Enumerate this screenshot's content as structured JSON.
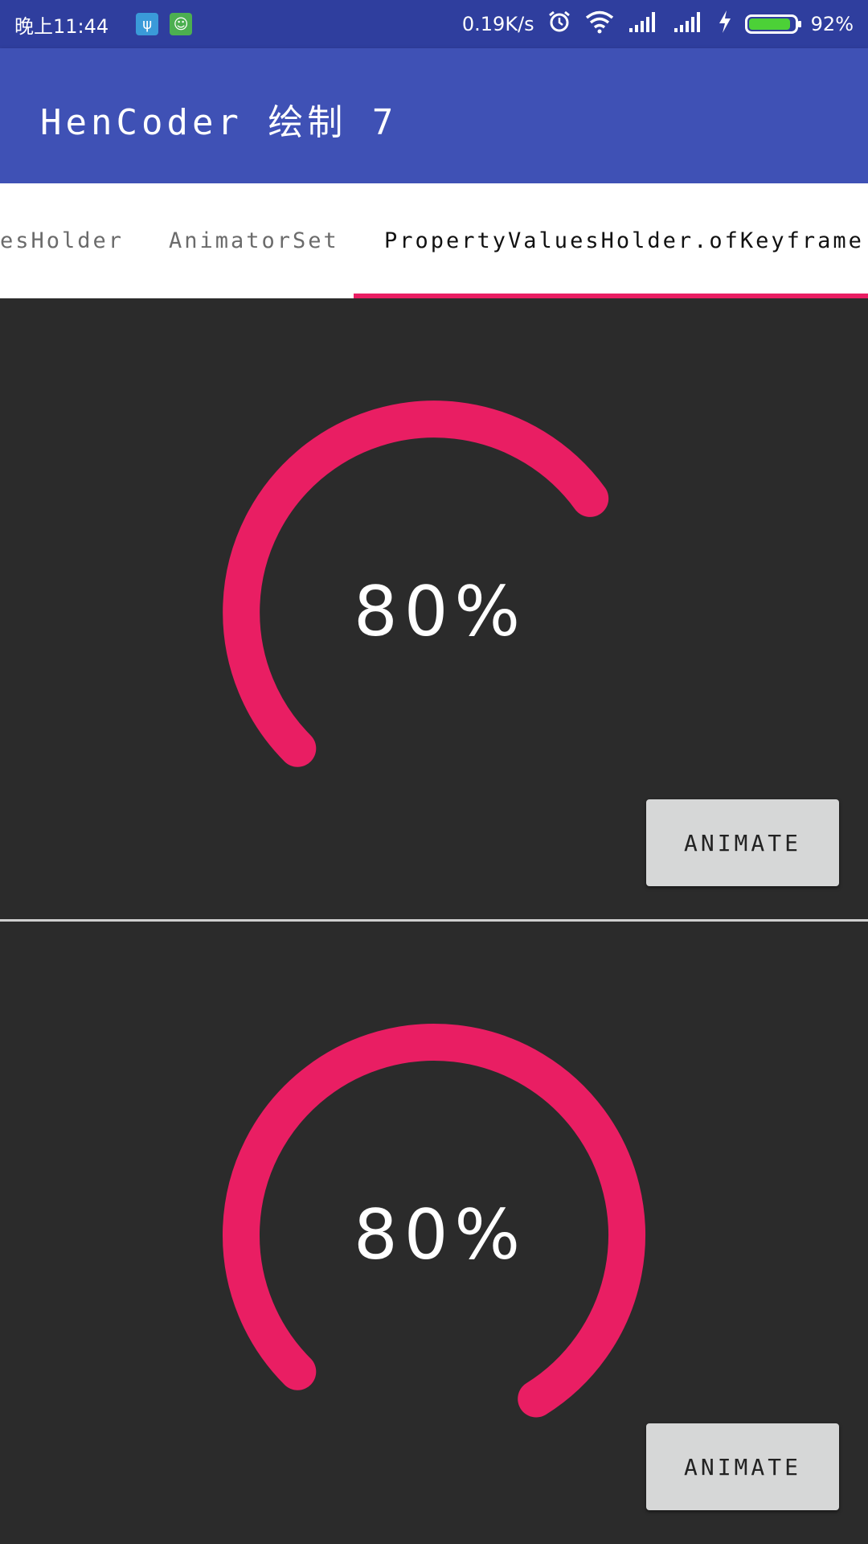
{
  "status_bar": {
    "time": "晚上11:44",
    "usb_icon": "usb-icon",
    "notification_icon": "android-icon",
    "net_speed": "0.19K/s",
    "battery_percent": "92%",
    "battery_level": 0.92,
    "icons": [
      "alarm-icon",
      "wifi-icon",
      "signal-icon",
      "signal-icon",
      "charging-icon",
      "battery-icon"
    ]
  },
  "app_bar": {
    "title": "HenCoder 绘制 7"
  },
  "tabs": {
    "items": [
      {
        "label": "esHolder",
        "active": false
      },
      {
        "label": "AnimatorSet",
        "active": false
      },
      {
        "label": "PropertyValuesHolder.ofKeyframe()",
        "active": true
      }
    ],
    "indicator_color": "#e91e63"
  },
  "panels": [
    {
      "progress_text": "80%",
      "arc_sweep_degrees": 189,
      "button_label": "ANIMATE"
    },
    {
      "progress_text": "80%",
      "arc_sweep_degrees": 283,
      "button_label": "ANIMATE"
    }
  ],
  "colors": {
    "status_bar": "#2f3e9e",
    "app_bar": "#3f51b5",
    "arc": "#e91e63",
    "panel_bg": "#2b2b2b",
    "button": "#d6d7d7"
  }
}
